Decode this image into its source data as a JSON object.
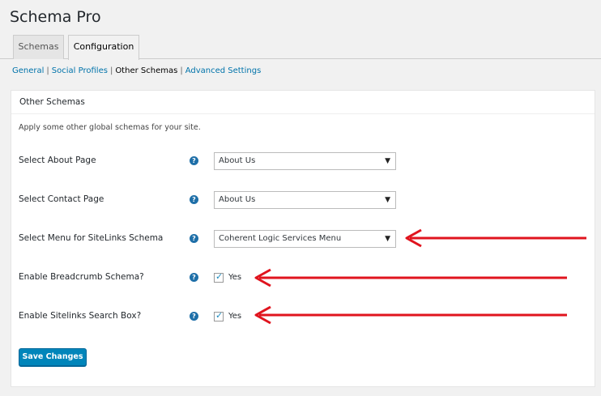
{
  "page": {
    "title": "Schema Pro"
  },
  "tabs": [
    {
      "label": "Schemas",
      "active": false
    },
    {
      "label": "Configuration",
      "active": true
    }
  ],
  "subnav": {
    "items": [
      "General",
      "Social Profiles",
      "Other Schemas",
      "Advanced Settings"
    ],
    "current": "Other Schemas",
    "separator": "|"
  },
  "panel": {
    "title": "Other Schemas",
    "description": "Apply some other global schemas for your site.",
    "rows": [
      {
        "label": "Select About Page",
        "type": "select",
        "value": "About Us"
      },
      {
        "label": "Select Contact Page",
        "type": "select",
        "value": "About Us"
      },
      {
        "label": "Select Menu for SiteLinks Schema",
        "type": "select",
        "value": "Coherent Logic Services Menu"
      },
      {
        "label": "Enable Breadcrumb Schema?",
        "type": "checkbox",
        "checked": true,
        "check_label": "Yes"
      },
      {
        "label": "Enable Sitelinks Search Box?",
        "type": "checkbox",
        "checked": true,
        "check_label": "Yes"
      }
    ],
    "save_label": "Save Changes",
    "help_icon": "?"
  },
  "colors": {
    "accent": "#0085ba",
    "link": "#0073aa",
    "annotation_arrow": "#e0141e"
  },
  "icons": {
    "help": "question-circle-icon",
    "dropdown": "caret-down-icon",
    "checkbox": "check-icon"
  }
}
